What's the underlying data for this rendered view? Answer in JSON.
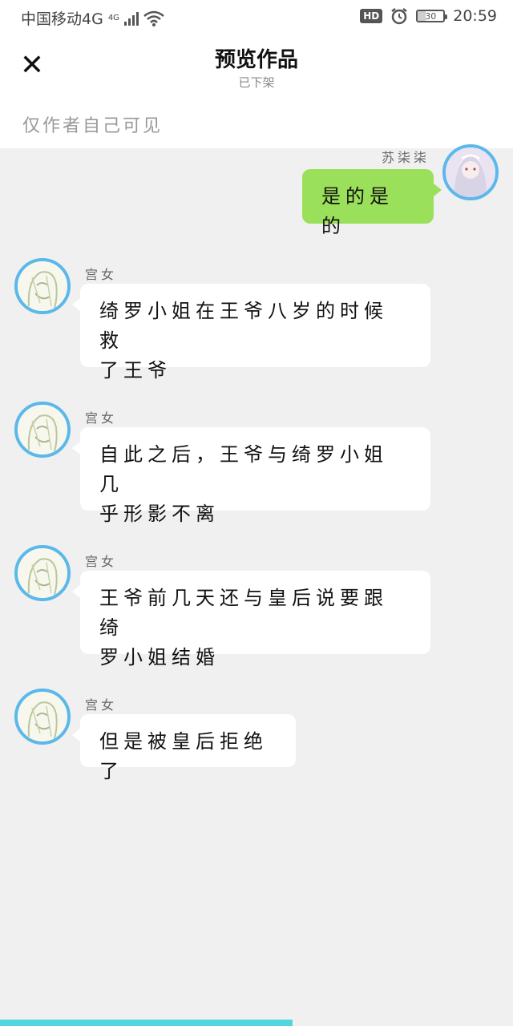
{
  "status_bar": {
    "carrier": "中国移动4G",
    "network_badge": "4G",
    "hd_badge": "HD",
    "battery_level": "30",
    "battery_fraction": 0.3,
    "time": "20:59",
    "icons": [
      "signal-icon",
      "wifi-icon",
      "alarm-icon",
      "battery-icon"
    ]
  },
  "header": {
    "close_icon": "✕",
    "title": "预览作品",
    "subtitle": "已下架",
    "visibility_note": "仅作者自己可见"
  },
  "colors": {
    "accent_blue": "#5bb8ea",
    "my_bubble": "#9be05a",
    "progress": "#4fd6e0",
    "background": "#f0f0f0"
  },
  "messages": [
    {
      "sender": "苏柒柒",
      "side": "right",
      "text": "是的是的"
    },
    {
      "sender": "宫女",
      "side": "left",
      "text_lines": [
        "绮罗小姐在王爷八岁的时候救",
        "了王爷"
      ]
    },
    {
      "sender": "宫女",
      "side": "left",
      "text_lines": [
        "自此之后，王爷与绮罗小姐几",
        "乎形影不离"
      ]
    },
    {
      "sender": "宫女",
      "side": "left",
      "text_lines": [
        "王爷前几天还与皇后说要跟绮",
        "罗小姐结婚"
      ]
    },
    {
      "sender": "宫女",
      "side": "left",
      "text_lines": [
        "但是被皇后拒绝了"
      ]
    }
  ],
  "reading_progress": 0.57
}
